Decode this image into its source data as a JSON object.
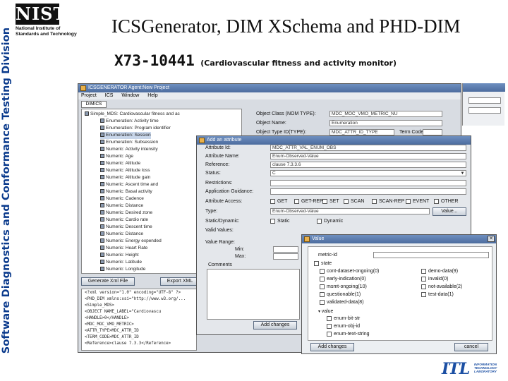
{
  "slide": {
    "side_banner": "Software Diagnostics and Conformance Testing Division",
    "logo": {
      "mark": "NIST",
      "line1": "National Institute of",
      "line2": "Standards and Technology"
    },
    "title": "ICSGenerator, DIM XSchema and PHD-DIM",
    "subtitle_main": "X73-10441",
    "subtitle_note": "(Cardiovascular fitness and activity monitor)",
    "itl_logo": {
      "mark": "ITL",
      "lines": [
        "INFORMATION",
        "TECHNOLOGY",
        "LABORATORY"
      ]
    }
  },
  "main_window": {
    "title": "ICSGENERATOR  Agent:New Project",
    "menu": [
      "Project",
      "ICS",
      "Window",
      "Help"
    ],
    "tab": "DIMICS",
    "tree": [
      "Simple_MDS: Cardiovascular fitness and ac",
      "Enumeration: Activity time",
      "Enumeration: Program identifier",
      "Enumeration: Session",
      "Enumeration: Subsession",
      "Numeric: Activity intensity",
      "Numeric: Age",
      "Numeric: Altitude",
      "Numeric: Altitude loss",
      "Numeric: Altitude gain",
      "Numeric: Ascent time and",
      "Numeric: Basal activity",
      "Numeric: Cadence",
      "Numeric: Distance",
      "Numeric: Desired zone",
      "Numeric: Cardio rate",
      "Numeric: Descent time",
      "Numeric: Distance",
      "Numeric: Energy expended",
      "Numeric: Heart Rate",
      "Numeric: Height",
      "Numeric: Latitude",
      "Numeric: Longitude"
    ],
    "fields": [
      {
        "label": "Object Class (NOM TYPE):",
        "value": "MDC_MOC_VMO_METRIC_NU"
      },
      {
        "label": "Object Name:",
        "value": "Enumeration"
      },
      {
        "label": "Object Type ID(TYPE):",
        "value": "MDC_ATTR_ID_TYPE",
        "extra_label": "Term Code:"
      }
    ],
    "buttons": {
      "generate": "Generate Xml File",
      "export": "Export XML"
    },
    "code": [
      "<?xml version=\"1.0\" encoding=\"UTF-8\" ?>",
      "<PHD_DIM xmlns:xsi=\"http://www.w3.org/...",
      " <Simple_MDS>",
      "  <OBJECT NAME_LABEL=\"Cardiovascu",
      "  <HANDLE>0</HANDLE>",
      "  <MDC_MOC_VMO_METRIC>",
      "  <ATTR_TYPE>MDC_ATTR_ID",
      "  <TERM_CODE>MDC_ATTR_ID",
      "  <Reference>clause 7.3.3</Reference>"
    ]
  },
  "attr_dialog": {
    "title": "Add an attribute",
    "rows": [
      {
        "label": "Attribute Id:",
        "value": "MDC_ATTR_VAL_ENUM_OBS"
      },
      {
        "label": "Attribute Name:",
        "value": "Enum-Observed-Value"
      },
      {
        "label": "Reference:",
        "value": "clause 7.3.3.6"
      },
      {
        "label": "Status:",
        "value": "C"
      },
      {
        "label": "Restrictions:",
        "value": ""
      },
      {
        "label": "Application Guidance:",
        "value": ""
      }
    ],
    "access_label": "Attribute Access:",
    "access_options": [
      "GET",
      "GET-REP",
      "SET",
      "SCAN",
      "SCAN-REP",
      "EVENT",
      "OTHER"
    ],
    "type_label": "Type:",
    "type_value": "Enum-Observed-Value",
    "value_button": "Value...",
    "static_label": "Static/Dynamic:",
    "static_options": [
      "Static",
      "Dynamic"
    ],
    "valid_values_label": "Valid Values:",
    "value_range_label": "Value Range:",
    "min_label": "Min:",
    "max_label": "Max:",
    "comments_label": "Comments",
    "add_changes": "Add changes"
  },
  "value_dialog": {
    "title": "Value",
    "root_label": "metric-id",
    "node_state": "state",
    "left_items": [
      "cont-dataset-ongoing(0)",
      "early-indication(0)",
      "msmt-ongoing(10)",
      "questionable(1)",
      "validated-data(8)"
    ],
    "right_items": [
      "demo-data(9)",
      "invalid(0)",
      "not-available(2)",
      "test-data(1)"
    ],
    "node_value": "value",
    "value_items": [
      "enum-bit-str",
      "enum-obj-id",
      "enum-text-string"
    ],
    "add_button": "Add changes",
    "cancel_button": "cancel"
  }
}
